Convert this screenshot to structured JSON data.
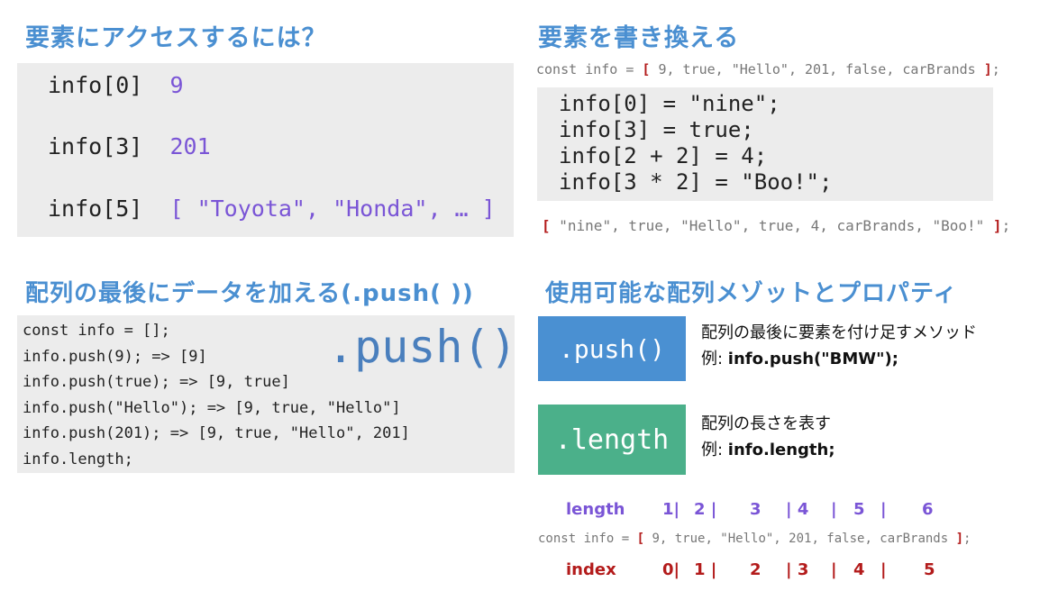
{
  "access": {
    "heading": "要素にアクセスするには？",
    "rows": [
      {
        "expr": "info[0]",
        "val": "9"
      },
      {
        "expr": "info[3]",
        "val": "201"
      },
      {
        "expr": "info[5]",
        "val": "[ \"Toyota\", \"Honda\", … ]"
      }
    ]
  },
  "rewrite": {
    "heading": "要素を書き換える",
    "decl": {
      "pre": "const info = ",
      "open": "[",
      "items": " 9, true, \"Hello\", 201, false, carBrands ",
      "close": "]",
      "post": ";"
    },
    "code": [
      "info[0] = \"nine\";",
      "info[3] = true;",
      "info[2 + 2] = 4;",
      "info[3 * 2] = \"Boo!\";"
    ],
    "result": {
      "open": "[",
      "items": " \"nine\", true, \"Hello\", true, 4, carBrands, \"Boo!\" ",
      "close": "]",
      "post": ";"
    }
  },
  "push_section": {
    "heading": "配列の最後にデータを加える(.push( ))",
    "code": [
      "const info = [];",
      "info.push(9); => [9]",
      "info.push(true); => [9, true]",
      "info.push(\"Hello\"); => [9, true, \"Hello\"]",
      "info.push(201); => [9, true, \"Hello\", 201]",
      "info.length;"
    ],
    "big_label": ".push()"
  },
  "methods": {
    "heading": "使用可能な配列メゾットとプロパティ",
    "push": {
      "button": ".push()",
      "desc": "配列の最後に要素を付け足すメソッド",
      "ex_label": "例: ",
      "ex_code": "info.push(\"BMW\");"
    },
    "length": {
      "button": ".length",
      "desc": "配列の長さを表す",
      "ex_label": "例: ",
      "ex_code": "info.length;"
    }
  },
  "diagram": {
    "length_label": "length",
    "length_marks": [
      "1|",
      "2 |",
      "3",
      "| 4",
      "|",
      "5",
      "|",
      "6"
    ],
    "decl": {
      "pre": "const info = ",
      "open": "[",
      "items": " 9, true, \"Hello\", 201, false, carBrands ",
      "close": "]",
      "post": ";"
    },
    "index_label": "index",
    "index_marks": [
      "0|",
      "1 |",
      "2",
      "| 3",
      "|",
      "4",
      "|",
      "5"
    ]
  },
  "colors": {
    "heading": "#4a8fd1",
    "purple": "#7a55d6",
    "red": "#b31b1b",
    "push_button": "#4a90d2",
    "length_button": "#4bb08a",
    "code_bg": "#ececec"
  }
}
